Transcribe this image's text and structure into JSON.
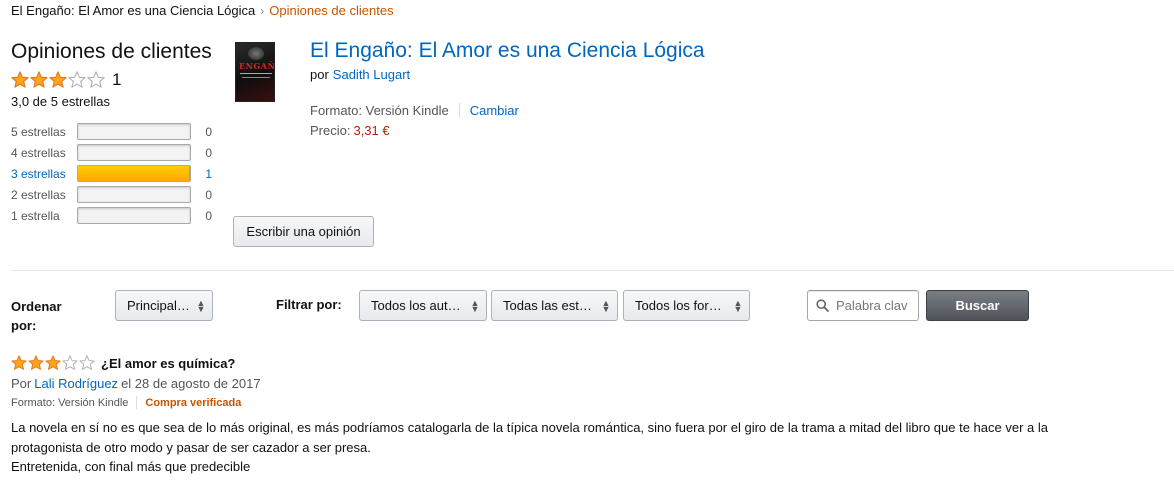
{
  "breadcrumb": {
    "book": "El Engaño: El Amor es una Ciencia Lógica",
    "separator": "›",
    "current": "Opiniones de clientes"
  },
  "summary": {
    "title": "Opiniones de clientes",
    "rating_stars": 3,
    "rating_count": "1",
    "average_text": "3,0 de 5 estrellas",
    "histogram": [
      {
        "label": "5 estrellas",
        "count": "0",
        "fraction": 0
      },
      {
        "label": "4 estrellas",
        "count": "0",
        "fraction": 0
      },
      {
        "label": "3 estrellas",
        "count": "1",
        "fraction": 1
      },
      {
        "label": "2 estrellas",
        "count": "0",
        "fraction": 0
      },
      {
        "label": "1 estrella",
        "count": "0",
        "fraction": 0
      }
    ]
  },
  "product": {
    "title": "El Engaño: El Amor es una Ciencia Lógica",
    "by_label": "por",
    "author": "Sadith Lugart",
    "format_label": "Formato: Versión Kindle",
    "change_label": "Cambiar",
    "price_label": "Precio:",
    "price": "3,31 €",
    "cover_text": "ENGAÑO"
  },
  "write_review_label": "Escribir una opinión",
  "controls": {
    "sort_label": "Ordenar por:",
    "sort_value": "Principales",
    "filter_label": "Filtrar por:",
    "filter_reviewers": "Todos los aut…",
    "filter_stars": "Todas las est…",
    "filter_formats": "Todos los for…",
    "search_placeholder": "Palabra clav",
    "search_button": "Buscar"
  },
  "review": {
    "stars": 3,
    "title": "¿El amor es química?",
    "by_prefix": "Por",
    "reviewer": "Lali Rodríguez",
    "date_text": "el 28 de agosto de 2017",
    "format": "Formato: Versión Kindle",
    "verified": "Compra verificada",
    "body_line1": "La novela en sí no es que sea de lo más original, es más podríamos catalogarla de la típica novela romántica, sino fuera por el giro de la trama a mitad del libro que te hace ver a la protagonista de otro modo y pasar de ser cazador a ser presa.",
    "body_line2": "Entretenida, con final más que predecible"
  },
  "colors": {
    "link": "#0066c0",
    "accent_orange": "#c45500",
    "price_red": "#b12704",
    "star_fill": "#ffa41c",
    "star_stroke": "#de7921"
  }
}
